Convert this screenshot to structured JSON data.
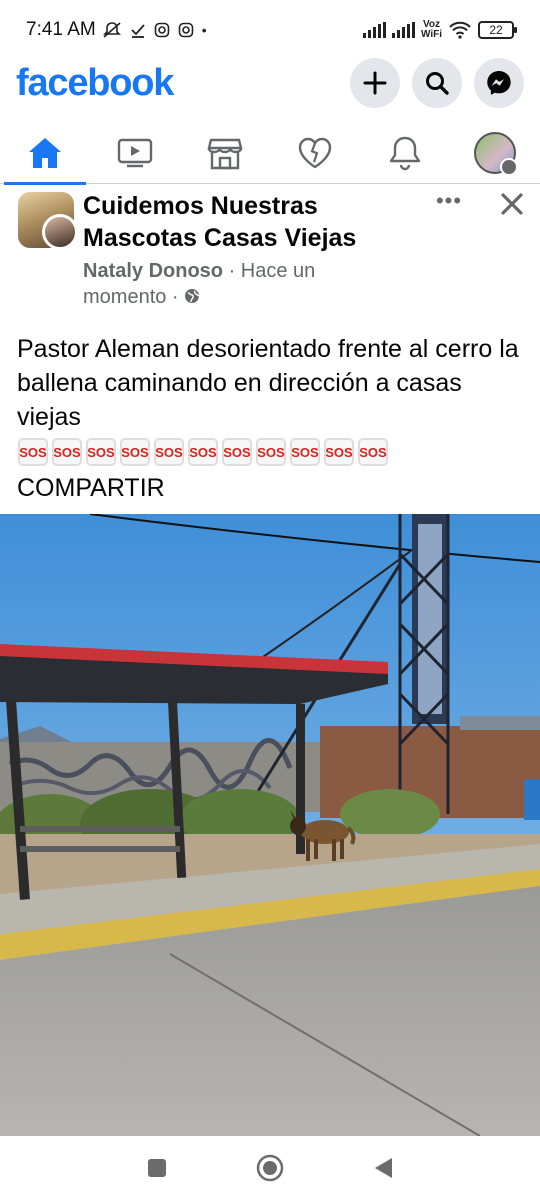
{
  "status_bar": {
    "time": "7:41 AM",
    "wifi_label_top": "Voz",
    "wifi_label_bottom": "WiFi",
    "battery": "22"
  },
  "header": {
    "logo": "facebook",
    "actions": [
      {
        "icon": "plus-icon"
      },
      {
        "icon": "search-icon"
      },
      {
        "icon": "messenger-icon"
      }
    ]
  },
  "tabs": [
    {
      "icon": "home-icon",
      "active": true
    },
    {
      "icon": "video-icon",
      "active": false
    },
    {
      "icon": "marketplace-icon",
      "active": false
    },
    {
      "icon": "dating-heart-icon",
      "active": false
    },
    {
      "icon": "bell-icon",
      "active": false
    },
    {
      "icon": "profile-menu-icon",
      "active": false
    }
  ],
  "post": {
    "group_name": "Cuidemos Nuestras Mascotas Casas Viejas",
    "author": "Nataly Donoso",
    "time_text": " · Hace un momento · ",
    "more_label": "•••",
    "text": "Pastor Aleman desorientado frente al cerro la ballena caminando en dirección a casas viejas",
    "sos": [
      "SOS",
      "SOS",
      "SOS",
      "SOS",
      "SOS",
      "SOS",
      "SOS",
      "SOS",
      "SOS",
      "SOS",
      "SOS"
    ],
    "share_text": "COMPARTIR"
  },
  "colors": {
    "brand": "#1877f2",
    "secondary_text": "#65676b",
    "sos_red": "#d9221c"
  }
}
